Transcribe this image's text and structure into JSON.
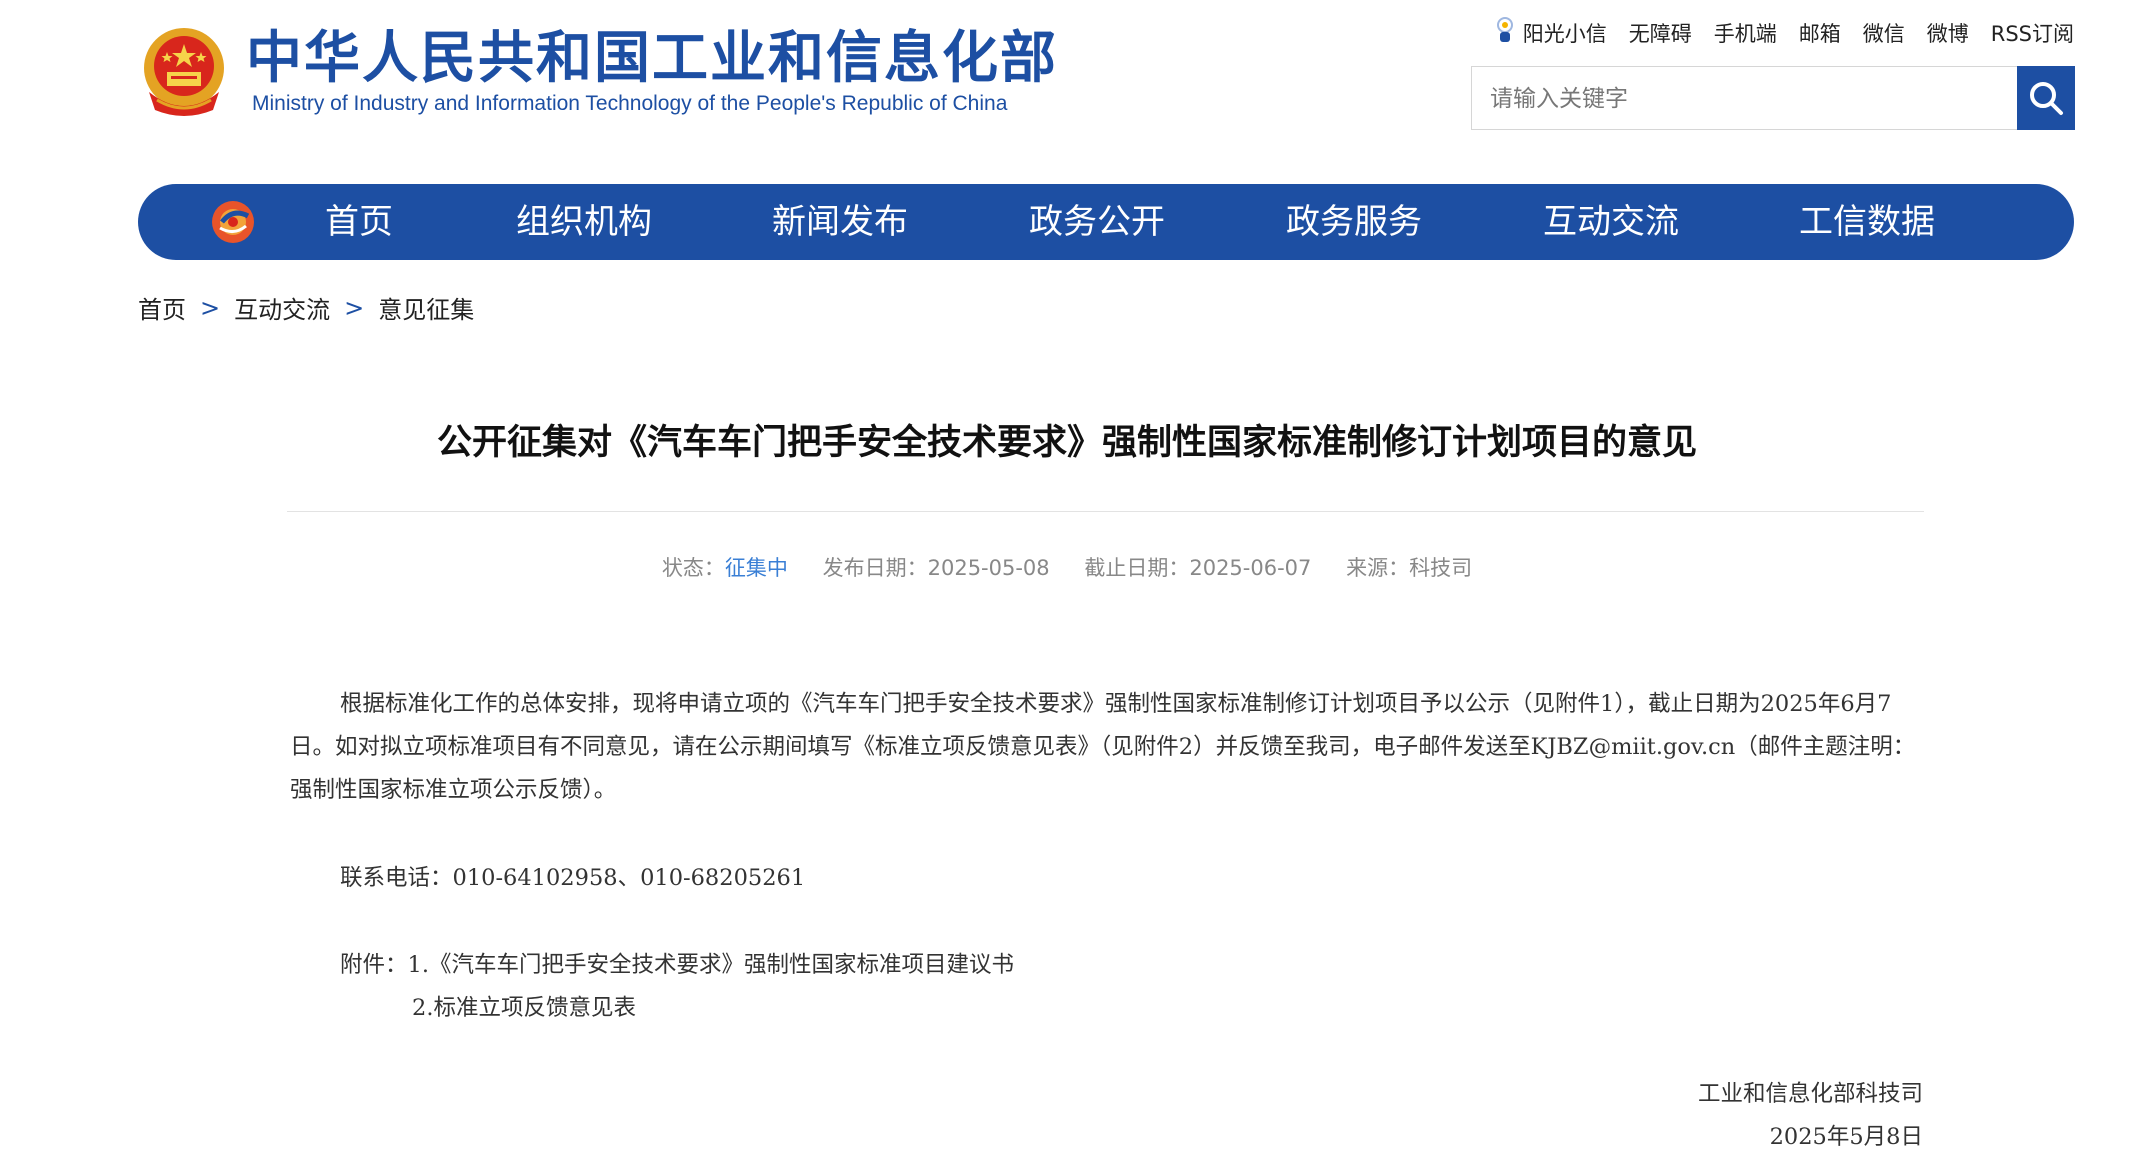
{
  "header": {
    "brand_cn": "中华人民共和国工业和信息化部",
    "brand_en": "Ministry of Industry and Information Technology of the People's Republic of China",
    "emblem_icon": "national-emblem-icon",
    "top_links": [
      "阳光小信",
      "无障碍",
      "手机端",
      "邮箱",
      "微信",
      "微博",
      "RSS订阅"
    ],
    "search": {
      "placeholder": "请输入关键字"
    }
  },
  "nav": {
    "items": [
      "首页",
      "组织机构",
      "新闻发布",
      "政务公开",
      "政务服务",
      "互动交流",
      "工信数据"
    ]
  },
  "breadcrumb": {
    "items": [
      "首页",
      "互动交流",
      "意见征集"
    ],
    "separator": ">"
  },
  "article": {
    "title": "公开征集对《汽车车门把手安全技术要求》强制性国家标准制修订计划项目的意见",
    "meta": {
      "status_label": "状态：",
      "status_value": "征集中",
      "publish_label": "发布日期：",
      "publish_value": "2025-05-08",
      "deadline_label": "截止日期：",
      "deadline_value": "2025-06-07",
      "source_label": "来源：",
      "source_value": "科技司"
    },
    "paragraph1": "根据标准化工作的总体安排，现将申请立项的《汽车车门把手安全技术要求》强制性国家标准制修订计划项目予以公示（见附件1），截止日期为2025年6月7日。如对拟立项标准项目有不同意见，请在公示期间填写《标准立项反馈意见表》（见附件2）并反馈至我司，电子邮件发送至KJBZ@miit.gov.cn（邮件主题注明：强制性国家标准立项公示反馈）。",
    "contact": "联系电话：010-64102958、010-68205261",
    "attachments_label": "附件：",
    "attachments": [
      "1.《汽车车门把手安全技术要求》强制性国家标准项目建议书",
      "2.标准立项反馈意见表"
    ],
    "sign_org": "工业和信息化部科技司",
    "sign_date": "2025年5月8日"
  },
  "colors": {
    "brand_blue": "#1d4fa3",
    "status_blue": "#3a7fd5"
  }
}
